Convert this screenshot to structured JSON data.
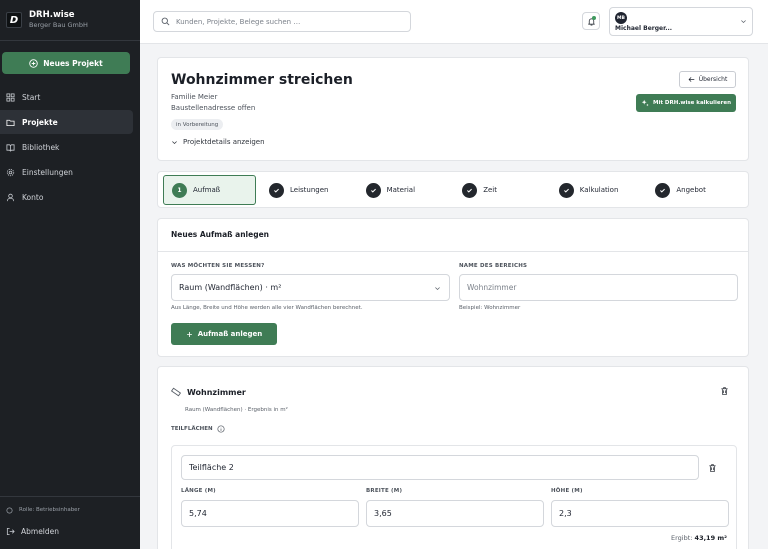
{
  "brand": {
    "name": "DRH.wise",
    "company": "Berger Bau GmbH",
    "logo_letter": "D"
  },
  "sidebar": {
    "new_project": "Neues Projekt",
    "items": [
      {
        "label": "Start",
        "icon": "grid-icon",
        "active": false
      },
      {
        "label": "Projekte",
        "icon": "folder-icon",
        "active": true
      },
      {
        "label": "Bibliothek",
        "icon": "book-icon",
        "active": false
      },
      {
        "label": "Einstellungen",
        "icon": "gear-icon",
        "active": false
      },
      {
        "label": "Konto",
        "icon": "user-icon",
        "active": false
      }
    ],
    "role": "Rolle: Betriebsinhaber",
    "logout": "Abmelden"
  },
  "topbar": {
    "search_placeholder": "Kunden, Projekte, Belege suchen …",
    "user_initials": "MB",
    "user_name": "Michael Berger..."
  },
  "project": {
    "title": "Wohnzimmer streichen",
    "client": "Familie Meier",
    "address": "Baustellenadresse offen",
    "status": "in Vorbereitung",
    "details_toggle": "Projektdetails anzeigen",
    "overview_button": "Übersicht",
    "calc_button": "Mit DRH.wise kalkulieren"
  },
  "steps": [
    {
      "number": "1",
      "label": "Aufmaß",
      "active": true
    },
    {
      "label": "Leistungen",
      "active": false
    },
    {
      "label": "Material",
      "active": false
    },
    {
      "label": "Zeit",
      "active": false
    },
    {
      "label": "Kalkulation",
      "active": false
    },
    {
      "label": "Angebot",
      "active": false
    }
  ],
  "new_measurement": {
    "title": "Neues Aufmaß anlegen",
    "measure_label": "WAS MÖCHTEN SIE MESSEN?",
    "measure_value": "Raum (Wandflächen) · m²",
    "measure_hint": "Aus Länge, Breite und Höhe werden alle vier Wandflächen berechnet.",
    "area_label": "NAME DES BEREICHS",
    "area_placeholder": "Wohnzimmer",
    "area_hint": "Beispiel: Wohnzimmer",
    "add_button": "Aufmaß anlegen"
  },
  "measurement": {
    "name": "Wohnzimmer",
    "subtitle": "Raum (Wandflächen) · Ergebnis in m²",
    "partial_label": "TEILFLÄCHEN",
    "partial": {
      "name": "Teilfläche 2",
      "length_label": "LÄNGE (M)",
      "length": "5,74",
      "width_label": "BREITE (M)",
      "width": "3,65",
      "height_label": "HÖHE (M)",
      "height": "2,3",
      "result_prefix": "Ergibt:",
      "result_value": "43,19 m²"
    }
  },
  "colors": {
    "accent": "#3f7c55",
    "sidebar": "#1d2024",
    "active_step_bg": "#e9f3ec"
  }
}
